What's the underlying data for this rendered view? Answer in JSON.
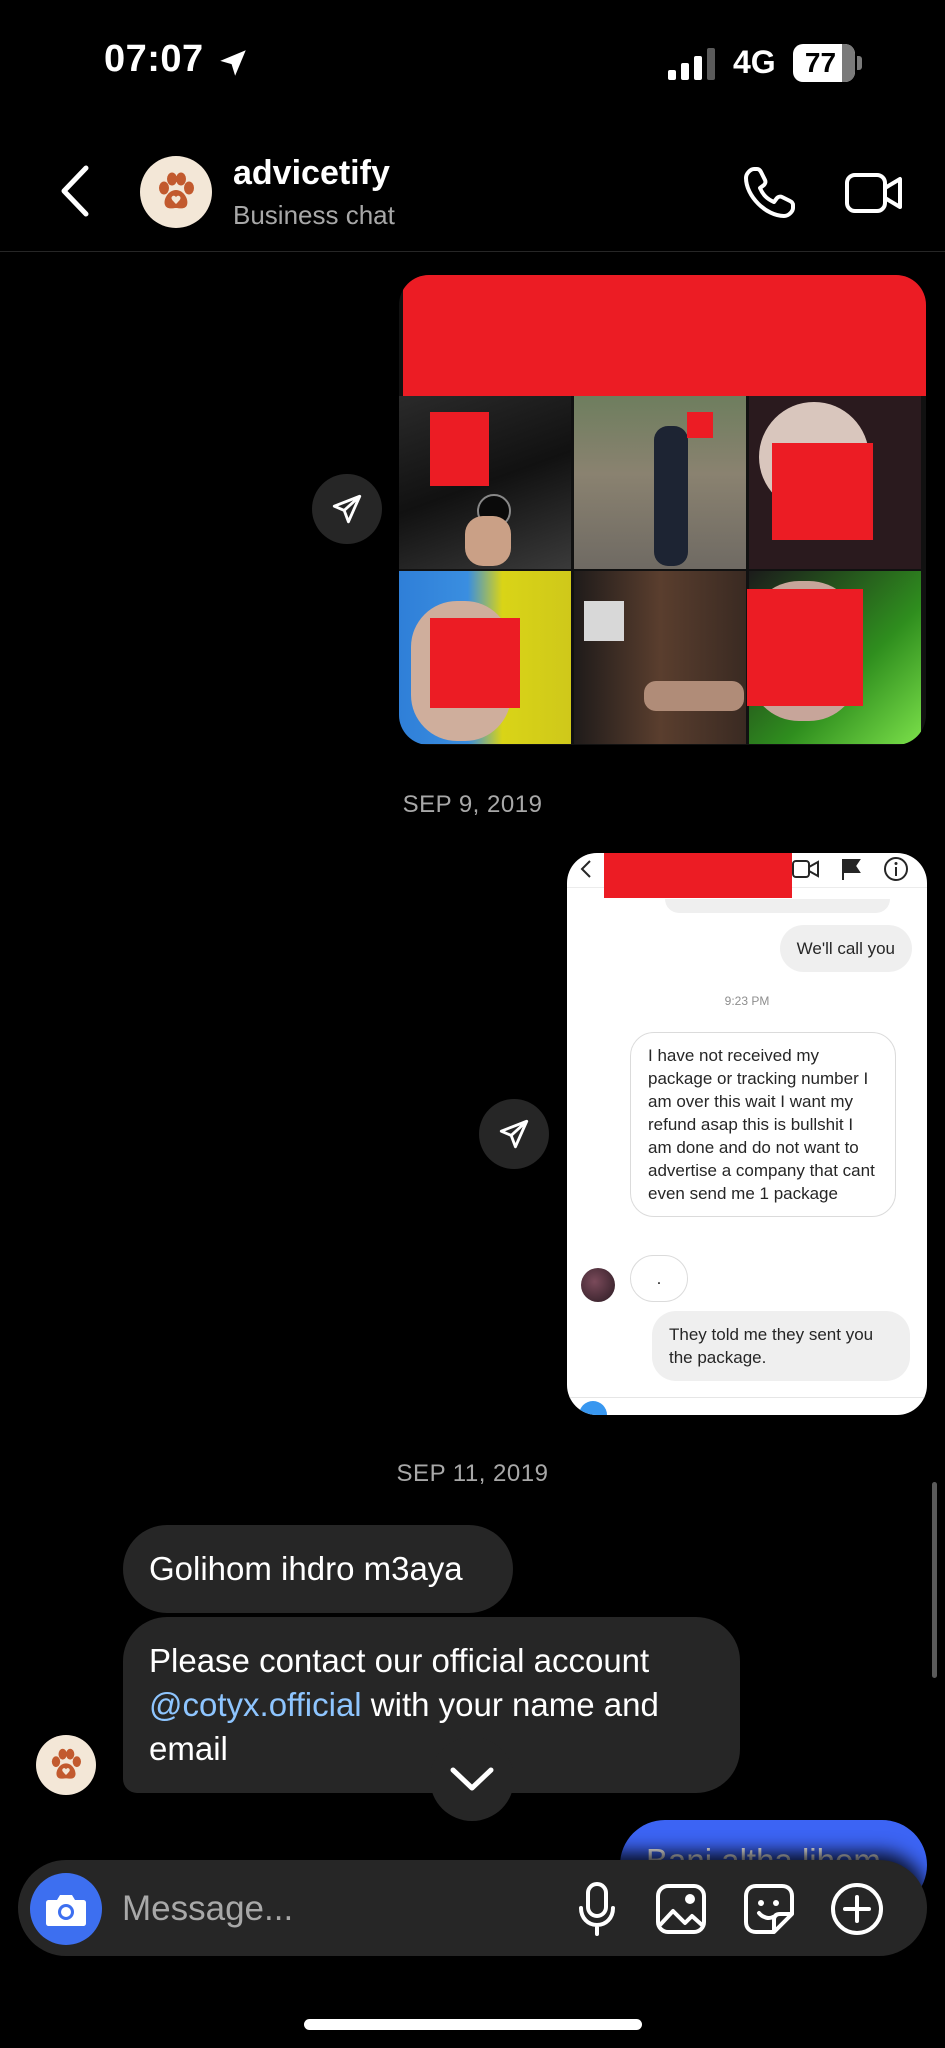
{
  "status_bar": {
    "time": "07:07",
    "network": "4G",
    "battery": "77"
  },
  "header": {
    "name": "advicetify",
    "subtitle": "Business chat"
  },
  "thread": {
    "date_1": "SEP 9, 2019",
    "date_2": "SEP 11, 2019",
    "screenshot": {
      "bubble_top": "We'll call you",
      "time": "9:23 PM",
      "bubble_complaint": "I have not received my package or tracking number I am over this wait I want my refund asap this is bullshit I am done and do not want to advertise a company that cant even send me 1 package",
      "bubble_dot": ".",
      "bubble_bottom": "They told me they sent you the package."
    },
    "incoming": [
      {
        "text": "Golihom ihdro m3aya"
      },
      {
        "text_before": "Please contact our official account ",
        "mention": "@cotyx.official",
        "text_after": " with your name and email"
      }
    ],
    "outgoing_partial": "Bani altha lihom"
  },
  "composer": {
    "placeholder": "Message..."
  },
  "colors": {
    "accent": "#3c64f4",
    "bubble_in": "#262626",
    "redaction": "#ec1c24",
    "background": "#000000"
  },
  "icons": [
    "location-arrow-icon",
    "signal-icon",
    "battery-icon",
    "back-chevron-icon",
    "paw-icon",
    "phone-icon",
    "video-icon",
    "share-icon",
    "chevron-down-icon",
    "camera-icon",
    "microphone-icon",
    "gallery-icon",
    "sticker-icon",
    "plus-circle-icon"
  ]
}
